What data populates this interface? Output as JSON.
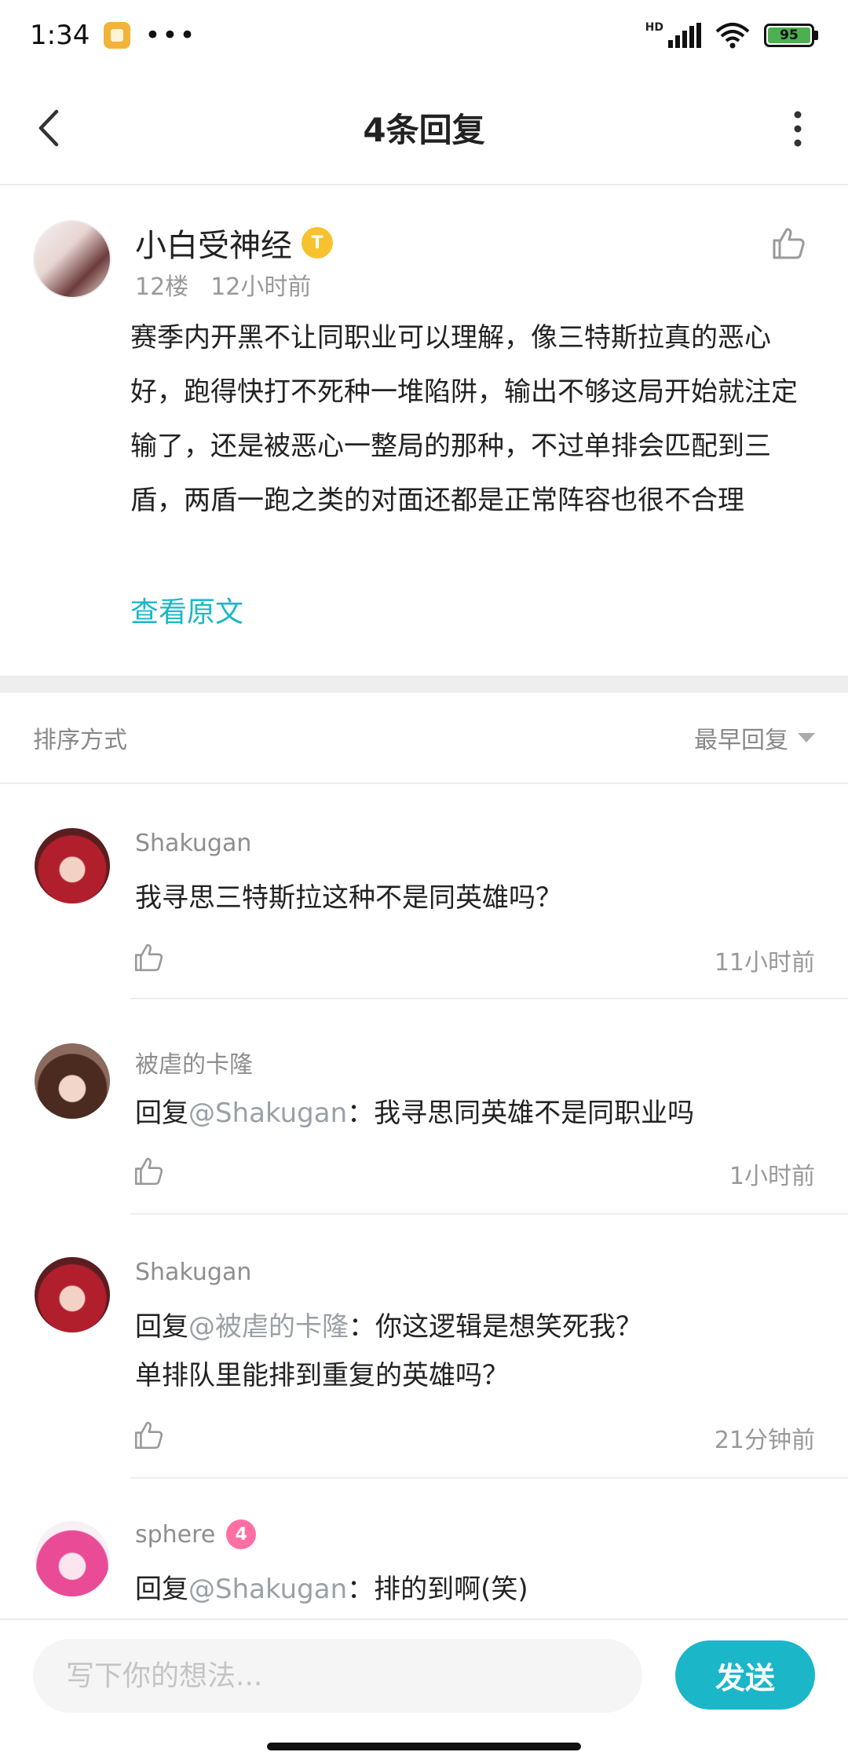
{
  "status_bar": {
    "time": "1:34",
    "dots": "•••",
    "hd": "HD",
    "battery": "95"
  },
  "header": {
    "title": "4条回复"
  },
  "post": {
    "author": "小白受神经",
    "badge": "T",
    "floor": "12楼",
    "time": "12小时前",
    "body": "赛季内开黑不让同职业可以理解，像三特斯拉真的恶心好，跑得快打不死种一堆陷阱，输出不够这局开始就注定输了，还是被恶心一整局的那种，不过单排会匹配到三盾，两盾一跑之类的对面还都是正常阵容也很不合理",
    "view_original": "查看原文"
  },
  "sort": {
    "label": "排序方式",
    "value": "最早回复"
  },
  "replies": [
    {
      "author": "Shakugan",
      "text": "我寻思三特斯拉这种不是同英雄吗？",
      "time": "11小时前"
    },
    {
      "author": "被虐的卡隆",
      "prefix": "回复",
      "mention": "@Shakugan",
      "text": "：我寻思同英雄不是同职业吗",
      "time": "1小时前"
    },
    {
      "author": "Shakugan",
      "prefix": "回复",
      "mention": "@被虐的卡隆",
      "text": "：你这逻辑是想笑死我？",
      "text2": "单排队里能排到重复的英雄吗？",
      "time": "21分钟前"
    },
    {
      "author": "sphere",
      "badge": "4",
      "prefix": "回复",
      "mention": "@Shakugan",
      "text": "：排的到啊(笑)"
    }
  ],
  "input": {
    "placeholder": "写下你的想法...",
    "send": "发送"
  },
  "colors": {
    "accent": "#1bb7c8",
    "gold_badge": "#f7c22e",
    "pink_badge": "#ff6fa3"
  }
}
